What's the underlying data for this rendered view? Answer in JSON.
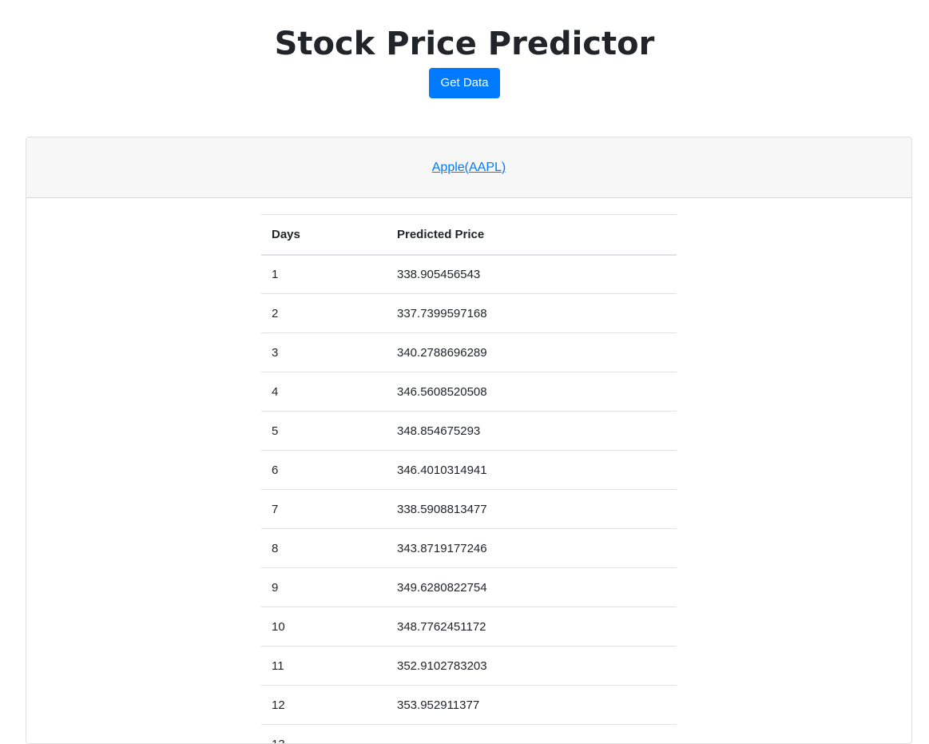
{
  "header": {
    "title": "Stock Price Predictor",
    "button_label": "Get Data"
  },
  "card": {
    "stock_link": "Apple(AAPL)"
  },
  "table": {
    "columns": [
      "Days",
      "Predicted Price"
    ],
    "rows": [
      [
        "1",
        "338.905456543"
      ],
      [
        "2",
        "337.7399597168"
      ],
      [
        "3",
        "340.2788696289"
      ],
      [
        "4",
        "346.5608520508"
      ],
      [
        "5",
        "348.854675293"
      ],
      [
        "6",
        "346.4010314941"
      ],
      [
        "7",
        "338.5908813477"
      ],
      [
        "8",
        "343.8719177246"
      ],
      [
        "9",
        "349.6280822754"
      ],
      [
        "10",
        "348.7762451172"
      ],
      [
        "11",
        "352.9102783203"
      ],
      [
        "12",
        "353.952911377"
      ],
      [
        "13",
        ""
      ]
    ]
  }
}
